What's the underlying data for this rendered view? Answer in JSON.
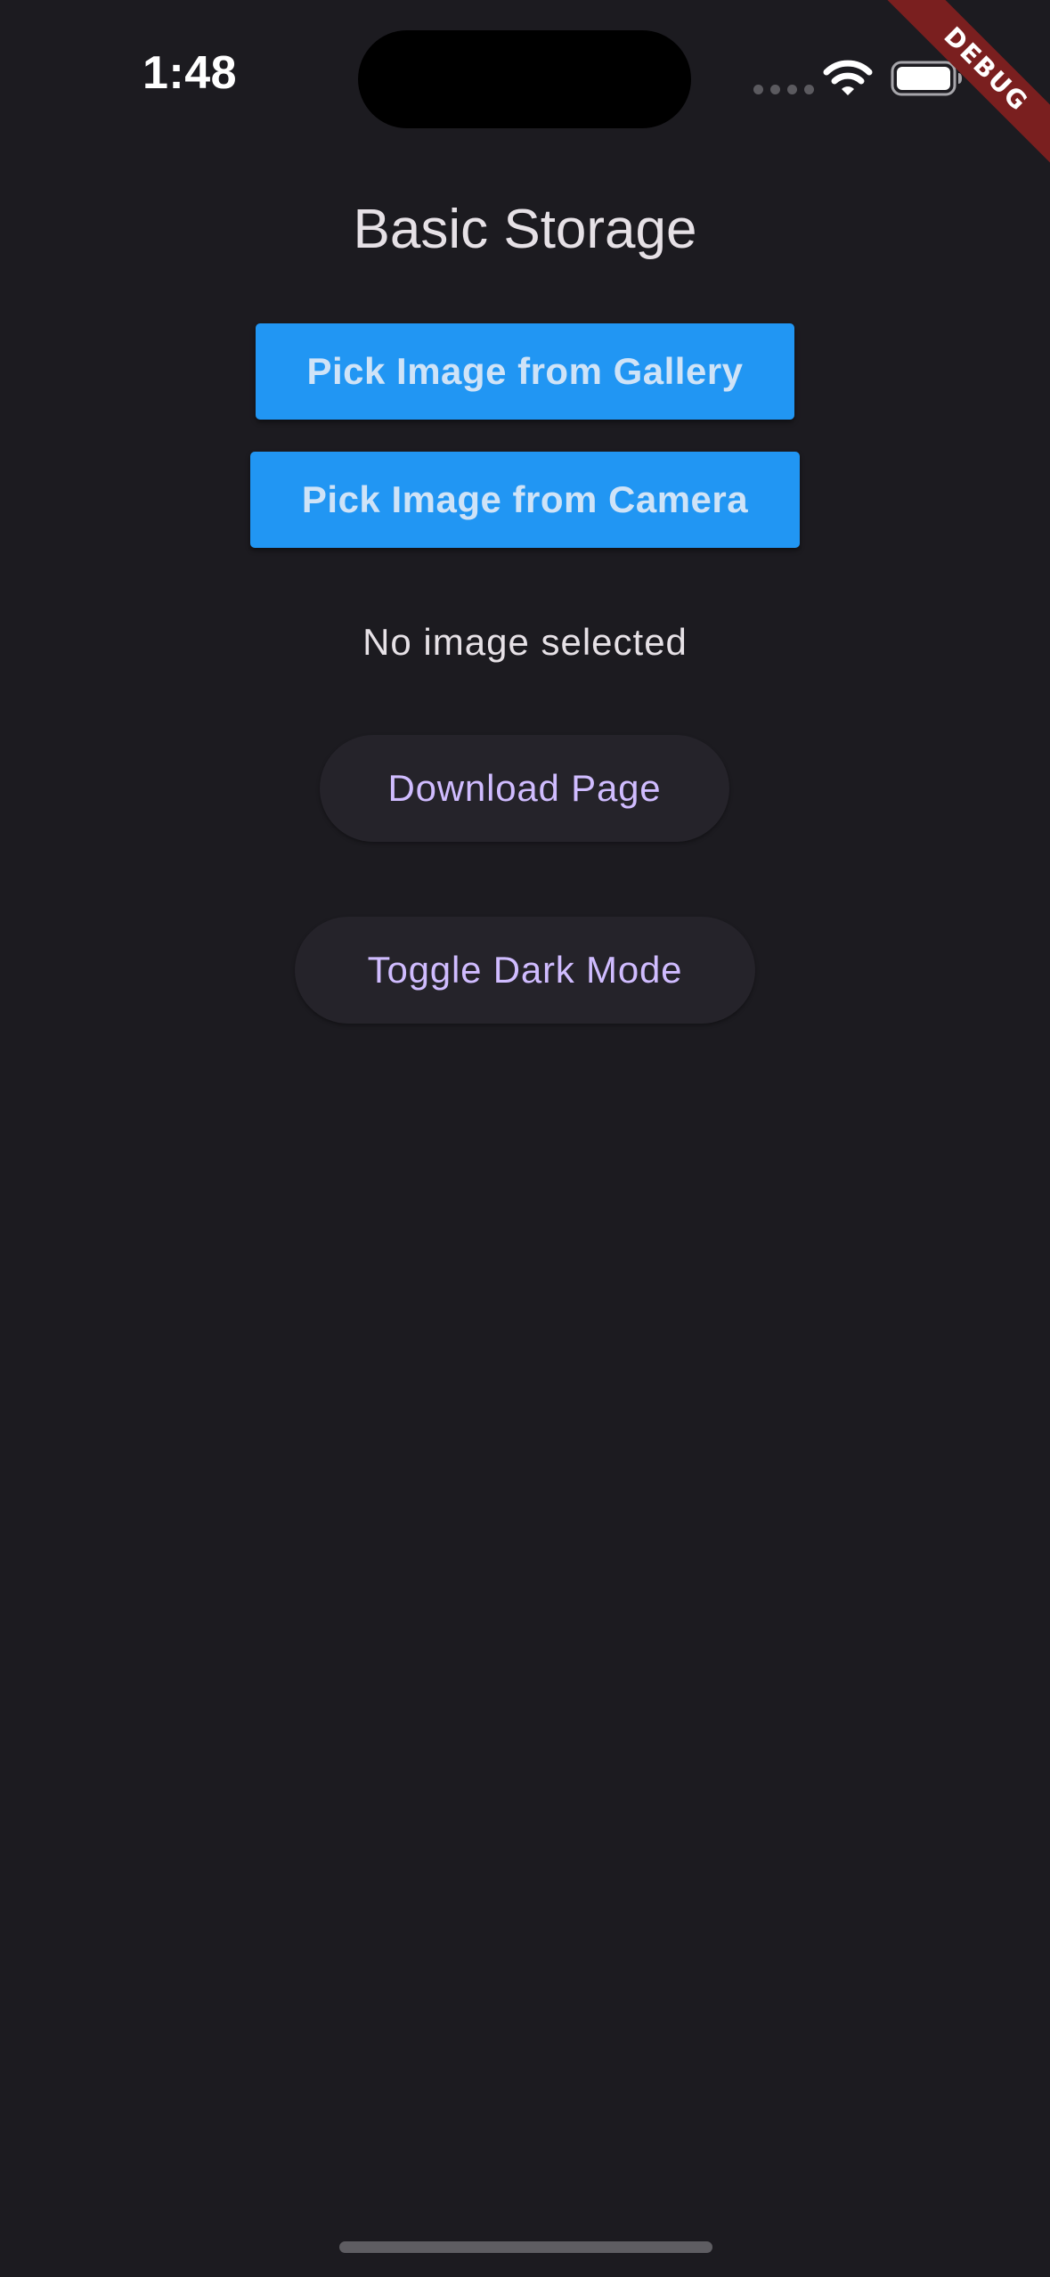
{
  "status_bar": {
    "time": "1:48",
    "icons": [
      "signal-dots-icon",
      "wifi-icon",
      "battery-icon"
    ]
  },
  "debug_banner": {
    "label": "DEBUG"
  },
  "page": {
    "title": "Basic Storage",
    "pick_gallery_label": "Pick Image from Gallery",
    "pick_camera_label": "Pick Image from Camera",
    "status_text": "No image selected",
    "download_label": "Download Page",
    "toggle_label": "Toggle Dark Mode"
  },
  "colors": {
    "background": "#1c1b20",
    "primary_button": "#2196f3",
    "pill_button": "#25232a",
    "pill_text": "#d0bcff",
    "debug_banner": "#7a1f1f"
  }
}
